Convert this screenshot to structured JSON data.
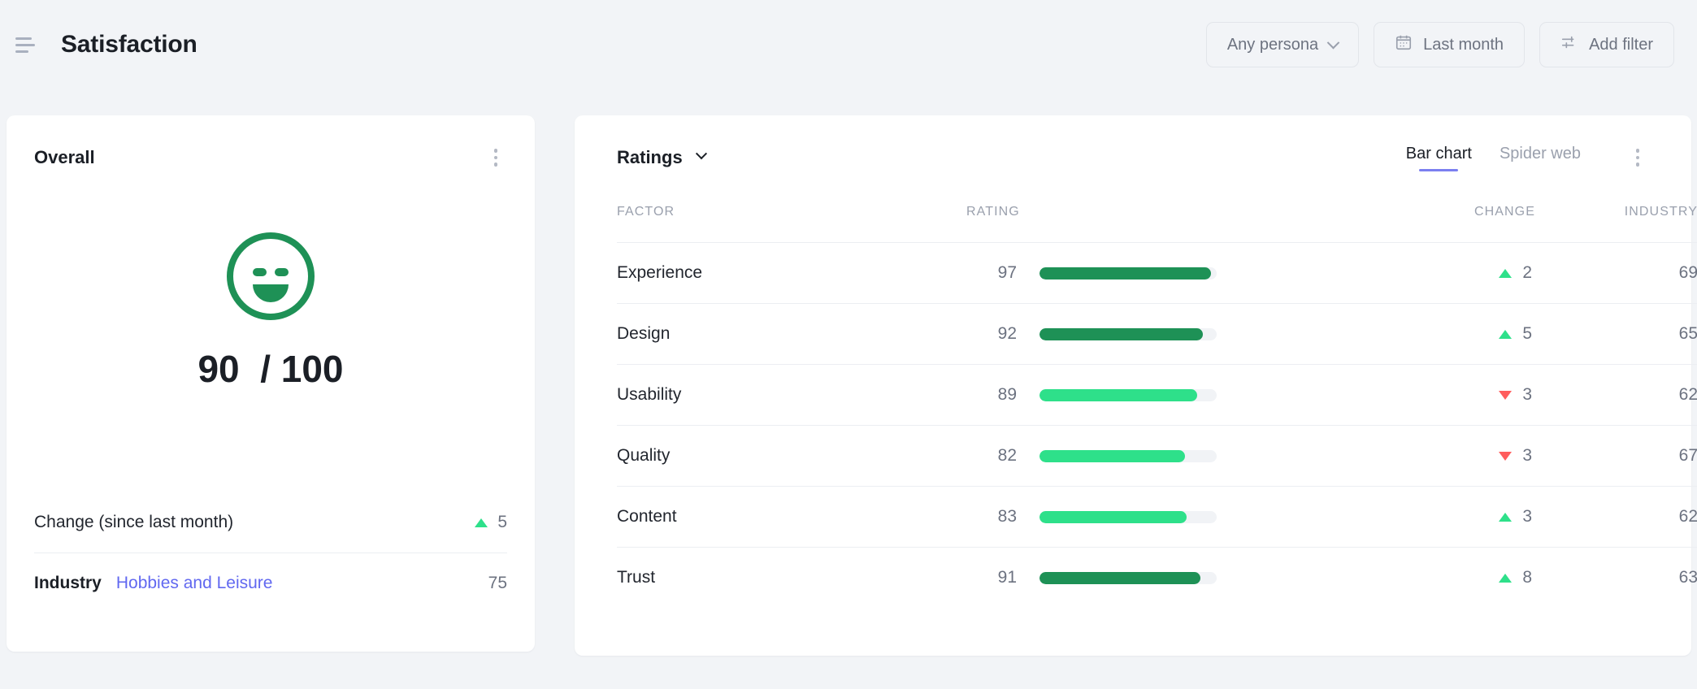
{
  "header": {
    "menu_icon": "hamburger-menu-icon",
    "title": "Satisfaction",
    "filters": [
      {
        "label": "Any persona",
        "icon": "chevron-down-icon"
      },
      {
        "label": "Last month",
        "icon": "calendar-icon"
      },
      {
        "label": "Add filter",
        "icon": "sliders-icon"
      }
    ]
  },
  "overall": {
    "title": "Overall",
    "menu_icon": "kebab-menu-icon",
    "face_icon": "smiley-happy-icon",
    "score": "90",
    "score_separator": " / ",
    "score_max": "100",
    "score_display": "90  / 100",
    "change_label": "Change (since last month)",
    "change_direction": "up",
    "change_value": "5",
    "industry_label": "Industry",
    "industry_name": "Hobbies and Leisure",
    "industry_value": "75"
  },
  "ratings": {
    "title": "Ratings",
    "title_icon": "chevron-down-icon",
    "menu_icon": "kebab-menu-icon",
    "tabs": [
      {
        "label": "Bar chart",
        "active": true
      },
      {
        "label": "Spider web",
        "active": false
      }
    ],
    "columns": [
      "FACTOR",
      "RATING",
      "CHANGE",
      "INDUSTRY"
    ]
  },
  "chart_data": {
    "type": "bar",
    "title": "Ratings",
    "xlabel": "",
    "ylabel": "",
    "xlim": [
      0,
      100
    ],
    "categories": [
      "Experience",
      "Design",
      "Usability",
      "Quality",
      "Content",
      "Trust"
    ],
    "series": [
      {
        "name": "Rating",
        "values": [
          97,
          92,
          89,
          82,
          83,
          91
        ]
      },
      {
        "name": "Change",
        "values": [
          2,
          5,
          -3,
          -3,
          3,
          8
        ]
      },
      {
        "name": "Industry",
        "values": [
          69,
          65,
          62,
          67,
          62,
          63
        ]
      }
    ],
    "rows": [
      {
        "factor": "Experience",
        "rating": 97,
        "bar_pct": 97,
        "bar_color": "#1e9156",
        "change": 2,
        "change_dir": "up",
        "industry": 69
      },
      {
        "factor": "Design",
        "rating": 92,
        "bar_pct": 92,
        "bar_color": "#1e9156",
        "change": 5,
        "change_dir": "up",
        "industry": 65
      },
      {
        "factor": "Usability",
        "rating": 89,
        "bar_pct": 89,
        "bar_color": "#2ee08a",
        "change": 3,
        "change_dir": "down",
        "industry": 62
      },
      {
        "factor": "Quality",
        "rating": 82,
        "bar_pct": 82,
        "bar_color": "#2ee08a",
        "change": 3,
        "change_dir": "down",
        "industry": 67
      },
      {
        "factor": "Content",
        "rating": 83,
        "bar_pct": 83,
        "bar_color": "#2ee08a",
        "change": 3,
        "change_dir": "up",
        "industry": 62
      },
      {
        "factor": "Trust",
        "rating": 91,
        "bar_pct": 91,
        "bar_color": "#1e9156",
        "change": 8,
        "change_dir": "up",
        "industry": 63
      }
    ],
    "legend": [],
    "grid": false
  },
  "colors": {
    "page_bg": "#f2f4f7",
    "card_bg": "#ffffff",
    "accent": "#7b7ff0",
    "link": "#6168f0",
    "green_dark": "#1e9156",
    "green_light": "#2ee08a",
    "red": "#ff5d5d",
    "track": "#f1f3f6",
    "text": "#1b1f26",
    "muted": "#9aa0ad"
  }
}
